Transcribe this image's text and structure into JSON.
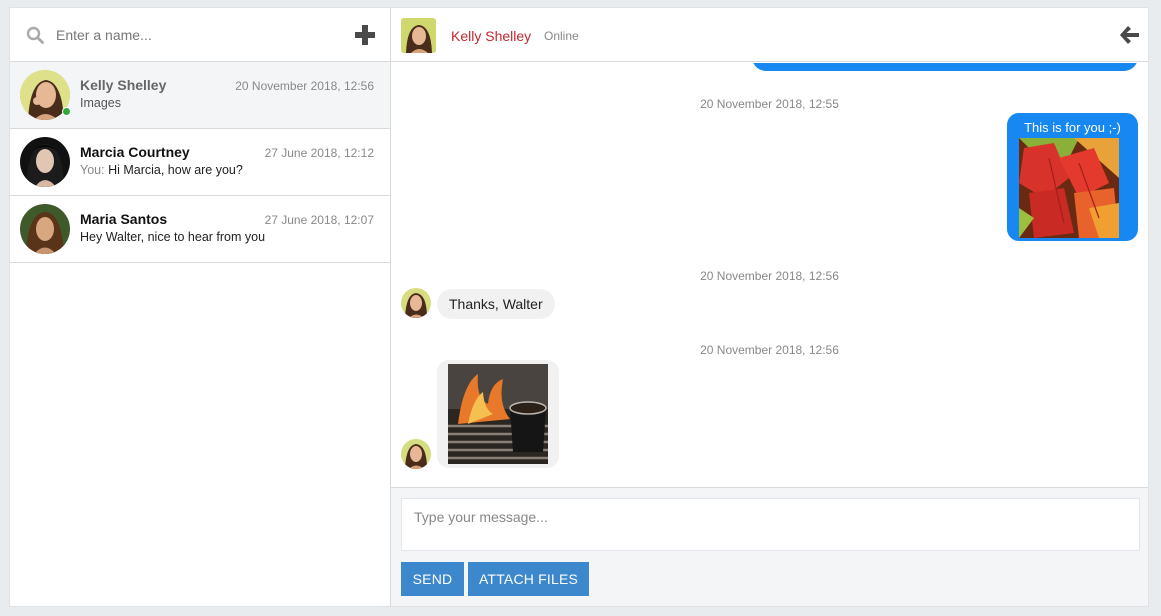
{
  "search": {
    "placeholder": "Enter a name..."
  },
  "contacts": [
    {
      "name": "Kelly Shelley",
      "date": "20 November 2018, 12:56",
      "you": "",
      "preview": "Images",
      "online": true,
      "active": true
    },
    {
      "name": "Marcia Courtney",
      "date": "27 June 2018, 12:12",
      "you": "You:",
      "preview": "Hi Marcia, how are you?",
      "online": false,
      "active": false
    },
    {
      "name": "Maria Santos",
      "date": "27 June 2018, 12:07",
      "you": "",
      "preview": "Hey Walter, nice to hear from you",
      "online": false,
      "active": false
    }
  ],
  "header": {
    "name": "Kelly Shelley",
    "status": "Online"
  },
  "messages": {
    "stamp1": "20 November 2018, 12:55",
    "out_text": "This is for you ;-)",
    "stamp2": "20 November 2018, 12:56",
    "in_text": "Thanks, Walter",
    "stamp3": "20 November 2018, 12:56"
  },
  "composer": {
    "placeholder": "Type your message...",
    "send_label": "SEND",
    "attach_label": "ATTACH FILES"
  },
  "colors": {
    "accent": "#1787f2",
    "button": "#3d87cd",
    "header_name": "#c2282c",
    "online": "#2eaa3a"
  }
}
